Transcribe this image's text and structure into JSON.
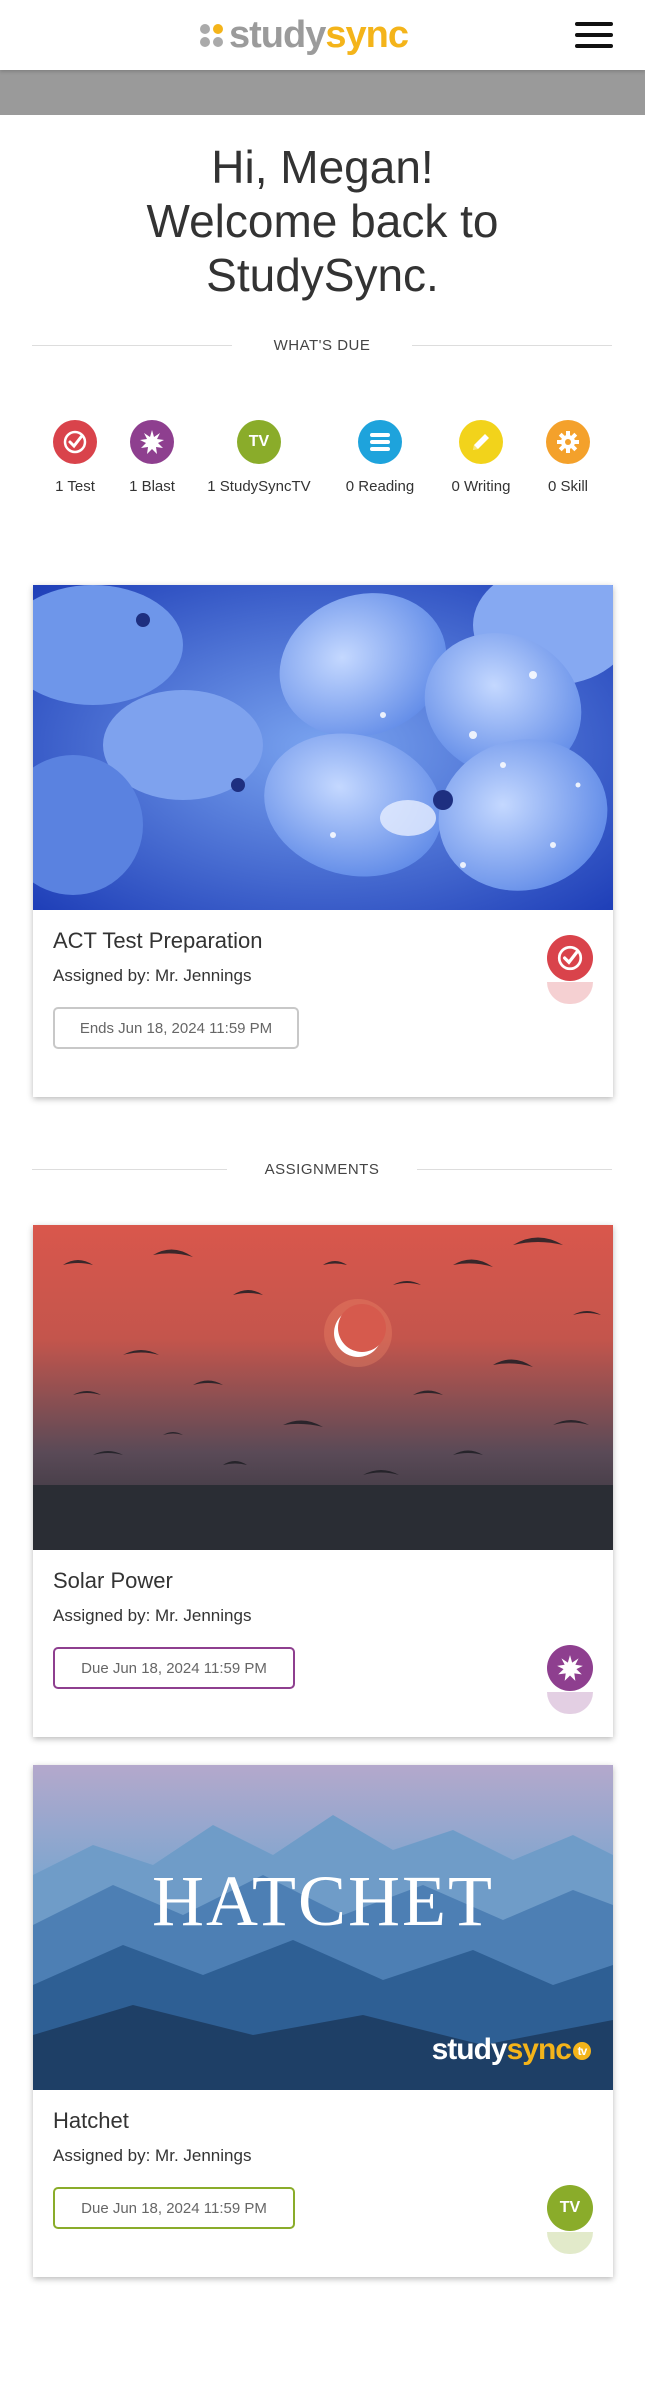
{
  "header": {
    "logo_study": "study",
    "logo_sync": "sync"
  },
  "greeting": {
    "line1": "Hi, Megan!",
    "line2": "Welcome back to",
    "line3": "StudySync."
  },
  "whats_due": {
    "heading": "WHAT'S DUE",
    "items": [
      {
        "label": "1 Test",
        "icon": "check-icon",
        "color": "#d9434b"
      },
      {
        "label": "1 Blast",
        "icon": "burst-icon",
        "color": "#8e3f8f"
      },
      {
        "label": "1 StudySyncTV",
        "icon": "tv-icon",
        "icon_text": "TV",
        "color": "#8aac2a"
      },
      {
        "label": "0 Reading",
        "icon": "reading-icon",
        "color": "#1ea3dc"
      },
      {
        "label": "0 Writing",
        "icon": "pencil-icon",
        "color": "#f2d31b"
      },
      {
        "label": "0 Skill",
        "icon": "gear-icon",
        "color": "#f4a12b"
      }
    ]
  },
  "assignments_heading": "ASSIGNMENTS",
  "cards": [
    {
      "title": "ACT Test Preparation",
      "assigned": "Assigned by: Mr. Jennings",
      "date": "Ends Jun 18, 2024 11:59 PM",
      "badge_icon": "check-icon",
      "badge_color": "#d9434b",
      "date_border": "#c8c8c8"
    },
    {
      "title": "Solar Power",
      "assigned": "Assigned by: Mr. Jennings",
      "date": "Due Jun 18, 2024 11:59 PM",
      "badge_icon": "burst-icon",
      "badge_color": "#8e3f8f",
      "date_border": "#8e3f8f"
    },
    {
      "title": "Hatchet",
      "assigned": "Assigned by: Mr. Jennings",
      "date": "Due Jun 18, 2024 11:59 PM",
      "badge_icon": "tv-icon",
      "badge_text": "TV",
      "badge_color": "#8aac2a",
      "date_border": "#8aac2a",
      "image_title": "HATCHET",
      "image_logo_study": "study",
      "image_logo_sync": "sync",
      "image_logo_tv": "tv"
    }
  ]
}
